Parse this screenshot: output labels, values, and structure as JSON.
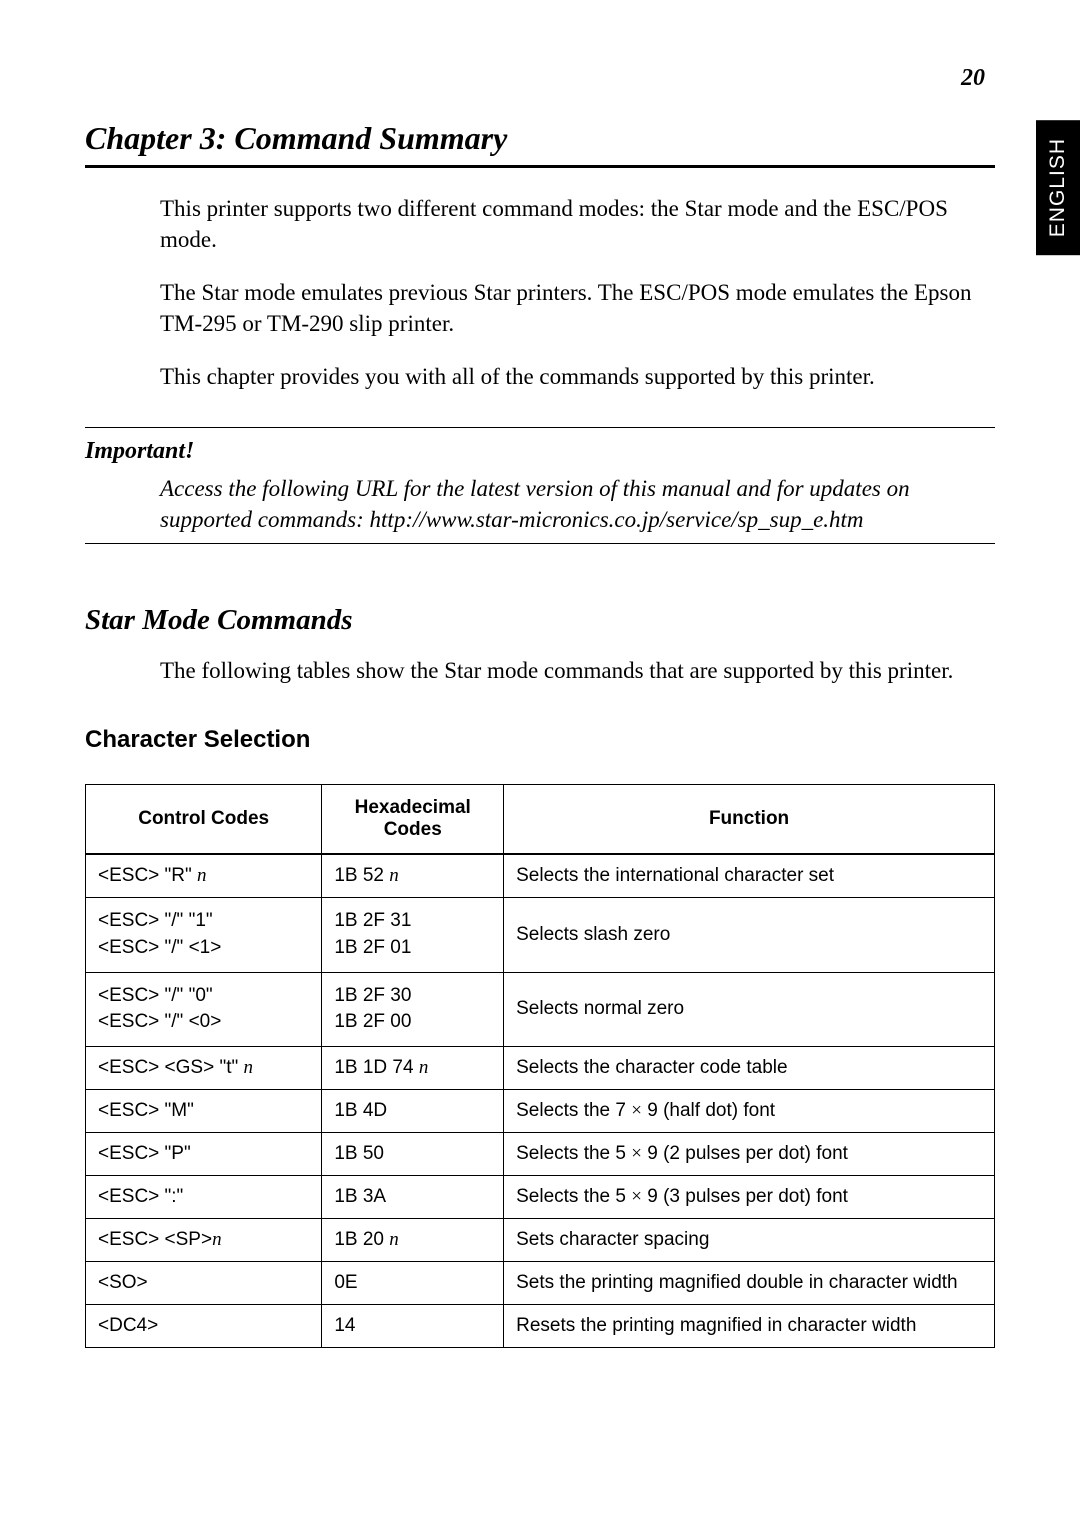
{
  "page_number": "20",
  "side_tab": "ENGLISH",
  "chapter_title": "Chapter 3:  Command Summary",
  "intro": {
    "p1": "This printer supports two different command modes: the Star mode and the ESC/POS mode.",
    "p2": "The Star mode emulates previous Star printers. The ESC/POS mode emulates the Epson TM-295 or TM-290 slip printer.",
    "p3": "This chapter provides you with all of the commands supported by this printer."
  },
  "important": {
    "label": "Important!",
    "text": "Access the following URL for the latest version of this manual and for updates on supported commands: http://www.star-micronics.co.jp/service/sp_sup_e.htm"
  },
  "section_title": "Star Mode Commands",
  "section_intro": "The following tables show the Star mode commands that are supported by this printer.",
  "subsection_title": "Character Selection",
  "table": {
    "headers": {
      "col1": "Control Codes",
      "col2": "Hexadecimal Codes",
      "col3": "Function"
    },
    "rows": [
      {
        "codes_raw": "<ESC> \"R\" n",
        "hex_raw": "1B 52 n",
        "func": "Selects the international character set"
      },
      {
        "codes_line1": "<ESC> \"/\" \"1\"",
        "codes_line2": "<ESC> \"/\" <1>",
        "hex_line1": "1B 2F 31",
        "hex_line2": "1B 2F 01",
        "func": "Selects slash zero"
      },
      {
        "codes_line1": "<ESC> \"/\" \"0\"",
        "codes_line2": "<ESC> \"/\" <0>",
        "hex_line1": "1B 2F 30",
        "hex_line2": "1B 2F 00",
        "func": "Selects normal zero"
      },
      {
        "codes_raw": "<ESC> <GS> \"t\" n",
        "hex_raw": "1B 1D 74 n",
        "func": "Selects the character code table"
      },
      {
        "codes": "<ESC> \"M\"",
        "hex": "1B 4D",
        "func_pre": "Selects the 7 ",
        "func_post": " 9 (half dot) font"
      },
      {
        "codes": "<ESC> \"P\"",
        "hex": "1B 50",
        "func_pre": "Selects the 5 ",
        "func_post": " 9 (2 pulses per dot) font"
      },
      {
        "codes": "<ESC> \":\"",
        "hex": "1B 3A",
        "func_pre": "Selects the 5 ",
        "func_post": " 9 (3 pulses per dot) font"
      },
      {
        "codes_raw": "<ESC> <SP>n",
        "hex_raw": "1B 20 n",
        "func": "Sets character spacing"
      },
      {
        "codes": "<SO>",
        "hex": "0E",
        "func": "Sets the printing magnified double in character width"
      },
      {
        "codes": "<DC4>",
        "hex": "14",
        "func": "Resets the printing magnified in character width"
      }
    ]
  }
}
